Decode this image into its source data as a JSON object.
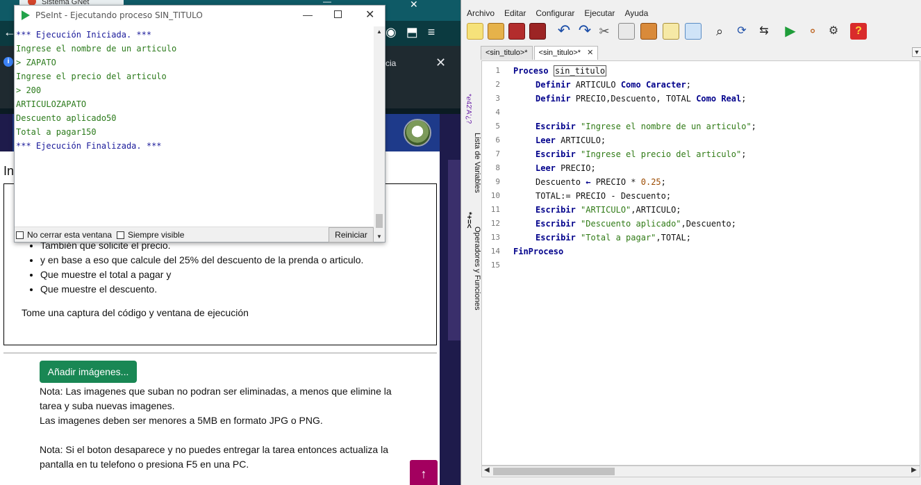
{
  "browser": {
    "tab_title": "Sistema GNet",
    "info_text": "cia",
    "page_heading": "Ins",
    "task_items": [
      "También que solicite el precio.",
      "y en base a eso que calcule del 25% del descuento de la prenda o articulo.",
      "Que muestre el total a pagar y",
      "Que muestre el descuento."
    ],
    "task_note": "Tome una captura del código y ventana de ejecución",
    "add_images_label": "Añadir imágenes...",
    "notes": [
      "Nota: Las imagenes que suban no podran ser eliminadas, a menos que elimine la tarea y suba nuevas imagenes.",
      "Las imagenes deben ser menores a 5MB en formato JPG o PNG.",
      "",
      "Nota: Si el boton desaparece y no puedes entregar la tarea entonces actualiza la pantalla en tu telefono o presiona F5 en una PC."
    ],
    "up_arrow": "↑"
  },
  "exec_window": {
    "title": "PSeInt - Ejecutando proceso SIN_TITULO",
    "lines": [
      {
        "kind": "sys",
        "text": "*** Ejecución Iniciada. ***"
      },
      {
        "kind": "out",
        "text": "Ingrese el nombre de un articulo"
      },
      {
        "kind": "in",
        "text": "> ZAPATO"
      },
      {
        "kind": "out",
        "text": "Ingrese el precio del articulo"
      },
      {
        "kind": "in",
        "text": "> 200"
      },
      {
        "kind": "out",
        "text": "ARTICULOZAPATO"
      },
      {
        "kind": "out",
        "text": "Descuento aplicado50"
      },
      {
        "kind": "out",
        "text": "Total a pagar150"
      },
      {
        "kind": "sys",
        "text": "*** Ejecución Finalizada. ***"
      }
    ],
    "no_cerrar_label": "No cerrar esta ventana",
    "siempre_visible_label": "Siempre visible",
    "reiniciar_label": "Reiniciar"
  },
  "editor": {
    "menu": [
      "Archivo",
      "Editar",
      "Configurar",
      "Ejecutar",
      "Ayuda"
    ],
    "tabs": [
      "<sin_titulo>*",
      "<sin_titulo>*"
    ],
    "tab_close": "✕",
    "side_panel": {
      "variables_label": "Lista de Variables",
      "operators_label": "Operadores y Funciones"
    },
    "code_lines": [
      "1",
      "2",
      "3",
      "4",
      "5",
      "6",
      "7",
      "8",
      "9",
      "10",
      "11",
      "12",
      "13",
      "14",
      "15"
    ],
    "code": {
      "l1_kw": "Proceso",
      "l1_name": "sin_titulo",
      "l2_kw": "Definir",
      "l2_a": " ARTICULO ",
      "l2_kw2": "Como Caracter",
      "l3_kw": "Definir",
      "l3_a": " PRECIO,Descuento, TOTAL ",
      "l3_kw2": "Como Real",
      "l5_kw": "Escribir",
      "l5_s": "\"Ingrese el nombre de un articulo\"",
      "l6_kw": "Leer",
      "l6_a": " ARTICULO;",
      "l7_kw": "Escribir",
      "l7_s": "\"Ingrese el precio del articulo\"",
      "l8_kw": "Leer",
      "l8_a": " PRECIO;",
      "l9_a": "Descuento ",
      "l9_arrow": "←",
      "l9_b": " PRECIO ",
      "l9_op": "*",
      "l9_num": " 0.25",
      "l10_a": "TOTAL:= PRECIO - Descuento;",
      "l11_kw": "Escribir",
      "l11_s": "\"ARTICULO\"",
      "l11_a": ",ARTICULO;",
      "l12_kw": "Escribir",
      "l12_s": "\"Descuento aplicado\"",
      "l12_a": ",Descuento;",
      "l13_kw": "Escribir",
      "l13_s": "\"Total a pagar\"",
      "l13_a": ",TOTAL;",
      "l14_kw": "FinProceso"
    }
  },
  "colors": {
    "console_sys": "#1a1a9a",
    "console_out": "#2b7a1b",
    "keyword": "#00008b",
    "string": "#2f7a15",
    "button_green": "#198754",
    "up_button": "#a3005f"
  }
}
